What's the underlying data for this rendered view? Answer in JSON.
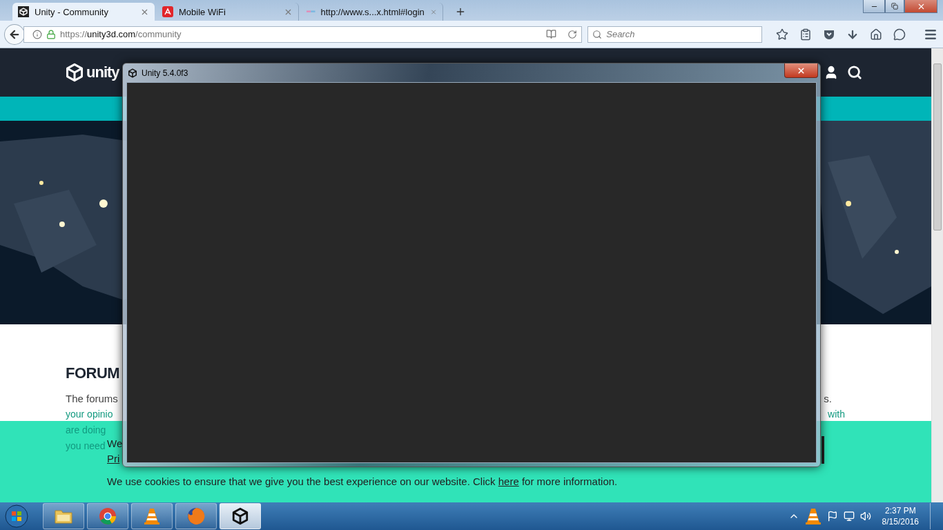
{
  "browser": {
    "tabs": [
      {
        "title": "Unity - Community",
        "selected": true,
        "kind": "unity"
      },
      {
        "title": "Mobile WiFi",
        "selected": false,
        "kind": "avira"
      },
      {
        "title": "http://www.s...x.html#login",
        "selected": false,
        "kind": "stripe"
      }
    ],
    "url": {
      "scheme": "https://",
      "host": "unity3d.com",
      "path": "/community"
    },
    "search": {
      "placeholder": "Search"
    }
  },
  "page": {
    "logo": "unity",
    "heading": "FORUM",
    "lines": [
      {
        "left": "The forums",
        "right": "s.",
        "faded": false
      },
      {
        "left": "your opinio",
        "right": "with",
        "faded": true
      },
      {
        "left": "are doing",
        "faded": true
      },
      {
        "left": "you need",
        "faded": true
      }
    ],
    "cookie": {
      "notice_start": "We",
      "notice_link": "Pri",
      "message": "We use cookies to ensure that we give you the best experience on our website. Click ",
      "link": "here",
      "message_end": " for more information."
    }
  },
  "unity_window": {
    "title": "Unity 5.4.0f3"
  },
  "taskbar": {
    "items": [
      {
        "kind": "explorer",
        "selected": false
      },
      {
        "kind": "chrome",
        "selected": false
      },
      {
        "kind": "vlc",
        "selected": false
      },
      {
        "kind": "firefox",
        "selected": false
      },
      {
        "kind": "unity",
        "selected": true
      }
    ],
    "time": "2:37 PM",
    "date": "8/15/2016"
  }
}
